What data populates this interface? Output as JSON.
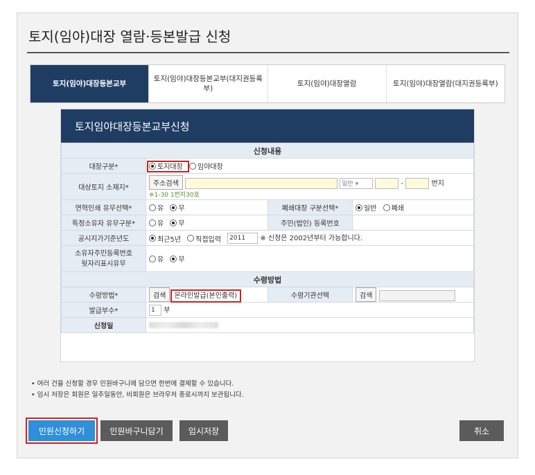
{
  "page": {
    "title": "토지(임야)대장 열람·등본발급 신청"
  },
  "tabs": [
    {
      "label": "토지(임야)대장등본교부",
      "active": true
    },
    {
      "label": "토지(임야)대장등본교부(대지권등록부)",
      "active": false
    },
    {
      "label": "토지(임야)대장열람",
      "active": false
    },
    {
      "label": "토지(임야)대장열람(대지권등록부)",
      "active": false
    }
  ],
  "panel": {
    "title": "토지임야대장등본교부신청"
  },
  "section1": {
    "title": "신청내용"
  },
  "rows": {
    "ledger_type": {
      "label": "대장구분*",
      "opt1": "토지대장",
      "opt2": "임야대장"
    },
    "location": {
      "label": "대상토지 소재지*",
      "search_btn": "주소검색",
      "select": "일반",
      "suffix": "번지",
      "hint": "※1-30 1번지30호"
    },
    "history": {
      "label": "연혁인쇄 유무선택*",
      "opt_yes": "유",
      "opt_no": "무"
    },
    "closed_type": {
      "label": "폐쇄대장 구분선택*",
      "opt1": "일반",
      "opt2": "폐쇄"
    },
    "owner": {
      "label": "특정소유자 유무구분*",
      "opt_yes": "유",
      "opt_no": "무"
    },
    "resident_no": {
      "label": "주민(법인) 등록번호"
    },
    "price_year": {
      "label": "공시지가기준년도",
      "opt1": "최근5년",
      "opt2": "직접입력",
      "year": "2011",
      "note": "※ 신청은 2002년부터 가능합니다."
    },
    "owner_id_suffix": {
      "label1": "소유자주민등록번호",
      "label2": "뒷자리표시유무",
      "opt_yes": "유",
      "opt_no": "무"
    }
  },
  "section2": {
    "title": "수령방법"
  },
  "receive": {
    "method_label": "수령방법*",
    "search_btn": "검색",
    "method_value": "온라인발급(본인출력)",
    "agency_label": "수령기관선택",
    "agency_search_btn": "검색",
    "copies_label": "발급부수*",
    "copies_value": "1",
    "copies_unit": "부",
    "date_label": "신청일"
  },
  "notes": [
    "• 여러 건을 신청할 경우 민원바구니에 담으면 한번에 결제할 수 있습니다.",
    "• 임시 저장은 회원은 일주일동안, 비회원은 브라우저 종료시까지 보관됩니다."
  ],
  "buttons": {
    "apply": "민원신청하기",
    "cart": "민원바구니담기",
    "save": "임시저장",
    "cancel": "취소"
  }
}
